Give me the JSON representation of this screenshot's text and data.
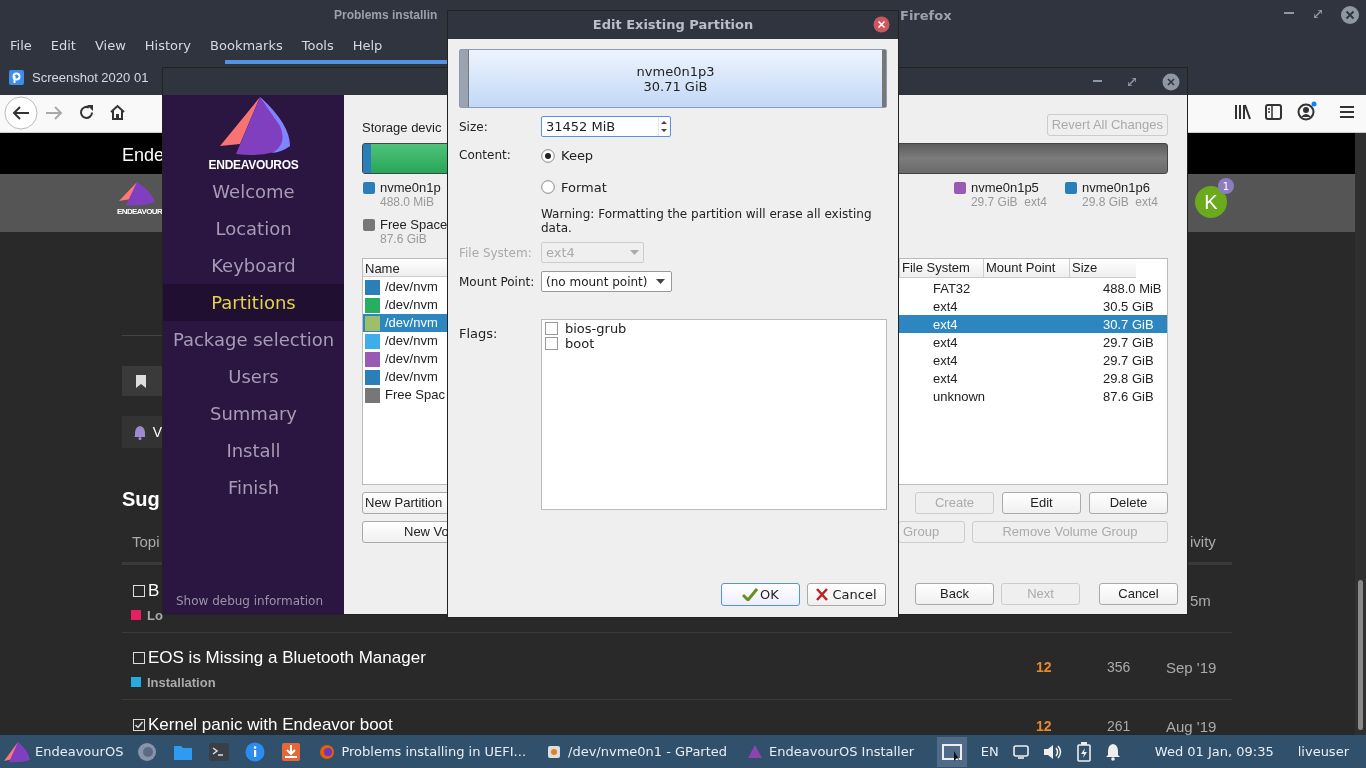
{
  "browser": {
    "title_parts": [
      "Problems installin",
      "Firefox"
    ],
    "menu": [
      "File",
      "Edit",
      "View",
      "History",
      "Bookmarks",
      "Tools",
      "Help"
    ],
    "tab": {
      "title": "Screenshot 2020 01"
    },
    "page": {
      "header_title": "Ende",
      "logo_text": "ENDEAVOUR",
      "avatar": "K",
      "badge": "1",
      "banner_letter": "V",
      "heading": "Sug",
      "topics_header": "Topi",
      "activity_header": "ivity",
      "topics": [
        {
          "title": "B",
          "checked": false,
          "category": "Lo",
          "color": "#e91e63",
          "activity": "5m"
        },
        {
          "title": "EOS is Missing a Bluetooth Manager",
          "checked": false,
          "category": "Installation",
          "color": "#25aae1",
          "replies": "12",
          "views": "356",
          "activity": "Sep '19"
        },
        {
          "title": "Kernel panic with Endeavor boot",
          "checked": true,
          "replies": "12",
          "views": "261",
          "activity": "Aug '19"
        }
      ]
    }
  },
  "installer": {
    "logo_text": "ENDEAVOUROS",
    "steps": [
      {
        "label": "Welcome",
        "selected": false
      },
      {
        "label": "Location",
        "selected": false
      },
      {
        "label": "Keyboard",
        "selected": false
      },
      {
        "label": "Partitions",
        "selected": true
      },
      {
        "label": "Package selection",
        "selected": false
      },
      {
        "label": "Users",
        "selected": false
      },
      {
        "label": "Summary",
        "selected": false
      },
      {
        "label": "Install",
        "selected": false
      },
      {
        "label": "Finish",
        "selected": false
      }
    ],
    "debug_link": "Show debug information",
    "storage_label": "Storage devic",
    "revert_button": {
      "label": "Revert All Changes",
      "disabled": true
    },
    "legend_left": [
      {
        "name": "nvme0n1p",
        "detail": "488.0 MiB",
        "color": "#2a7fba"
      },
      {
        "name": "Free Space",
        "detail": "87.6 GiB",
        "color": "#777777"
      }
    ],
    "legend_right": [
      {
        "name": "nvme0n1p5",
        "detail": "29.7 GiB  ext4",
        "color": "#9b59b6"
      },
      {
        "name": "nvme0n1p6",
        "detail": "29.8 GiB  ext4",
        "color": "#2a7fba"
      }
    ],
    "table": {
      "columns": [
        "Name",
        "File System",
        "Mount Point",
        "Size"
      ],
      "rows": [
        {
          "name": "/dev/nvm",
          "color": "#2a7fba",
          "file_system": "FAT32",
          "size": "488.0 MiB",
          "selected": false
        },
        {
          "name": "/dev/nvm",
          "color": "#27ae60",
          "file_system": "ext4",
          "size": "30.5 GiB",
          "selected": false
        },
        {
          "name": "/dev/nvm",
          "color": "#9dbe6b",
          "file_system": "ext4",
          "size": "30.7 GiB",
          "selected": true
        },
        {
          "name": "/dev/nvm",
          "color": "#3daee9",
          "file_system": "ext4",
          "size": "29.7 GiB",
          "selected": false
        },
        {
          "name": "/dev/nvm",
          "color": "#9b59b6",
          "file_system": "ext4",
          "size": "29.7 GiB",
          "selected": false
        },
        {
          "name": "/dev/nvm",
          "color": "#2a7fba",
          "file_system": "ext4",
          "size": "29.8 GiB",
          "selected": false
        },
        {
          "name": "Free Spac",
          "color": "#777777",
          "file_system": "unknown",
          "size": "87.6 GiB",
          "selected": false
        }
      ]
    },
    "new_partition": {
      "label": "New Partition",
      "disabled": false
    },
    "partition_buttons": [
      {
        "label": "Create",
        "disabled": true
      },
      {
        "label": "Edit",
        "disabled": false
      },
      {
        "label": "Delete",
        "disabled": false
      }
    ],
    "new_volume": {
      "label": "New Vo",
      "disabled": false
    },
    "volume_buttons": [
      {
        "label": "Group",
        "disabled": true
      },
      {
        "label": "Remove Volume Group",
        "disabled": true
      }
    ],
    "nav_buttons": [
      {
        "label": "Back",
        "disabled": false
      },
      {
        "label": "Next",
        "disabled": true
      },
      {
        "label": "Cancel",
        "disabled": false
      }
    ]
  },
  "dialog": {
    "title": "Edit Existing Partition",
    "partition_name": "nvme0n1p3",
    "partition_size": "30.71 GiB",
    "size_label": "Size:",
    "size_value": "31452 MiB",
    "content_label": "Content:",
    "content_options": [
      {
        "label": "Keep",
        "selected": true
      },
      {
        "label": "Format",
        "selected": false
      }
    ],
    "warning": "Warning: Formatting the partition will erase all existing data.",
    "fs_label": "File System:",
    "fs_value": "ext4",
    "fs_disabled": true,
    "mount_label": "Mount Point:",
    "mount_value": "(no mount point)",
    "flags_label": "Flags:",
    "flags": [
      {
        "label": "bios-grub",
        "checked": false
      },
      {
        "label": "boot",
        "checked": false
      }
    ],
    "ok": "OK",
    "cancel": "Cancel"
  },
  "taskbar": {
    "start": "EndeavourOS",
    "tasks": [
      {
        "label": "Problems installing in UEFI...",
        "kind": "firefox"
      },
      {
        "label": "/dev/nvme0n1 - GParted",
        "kind": "gparted"
      },
      {
        "label": "EndeavourOS Installer",
        "kind": "installer"
      }
    ],
    "language": "EN",
    "clock": "Wed 01 Jan, 09:35",
    "user": "liveuser"
  }
}
